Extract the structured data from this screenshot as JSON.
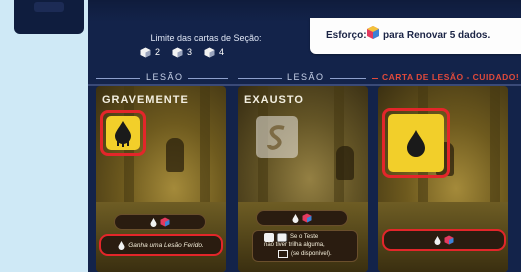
{
  "effort": {
    "label": "Esforço:",
    "text": "para Renovar 5 dados."
  },
  "section_limits": {
    "title": "Limite das cartas de Seção:",
    "items": [
      {
        "value": "2"
      },
      {
        "value": "3"
      },
      {
        "value": "4"
      }
    ]
  },
  "sections": [
    {
      "label": "LESÃO"
    },
    {
      "label": "LESÃO"
    },
    {
      "label": "CARTA DE LESÃO - CUIDADO!"
    }
  ],
  "cards": [
    {
      "title": "GRAVEMENTE",
      "effect": "Ganha uma Lesão Ferido."
    },
    {
      "title": "EXAUSTO",
      "effect_lines": [
        "Se o Teste",
        "não tiver trilha alguma,",
        "(se disponível)."
      ]
    },
    {
      "title": ""
    }
  ],
  "colors": {
    "board": "#13234a",
    "highlight": "#e3262a",
    "die_yellow": "#f2cf2a",
    "warning": "#e04a3b"
  }
}
